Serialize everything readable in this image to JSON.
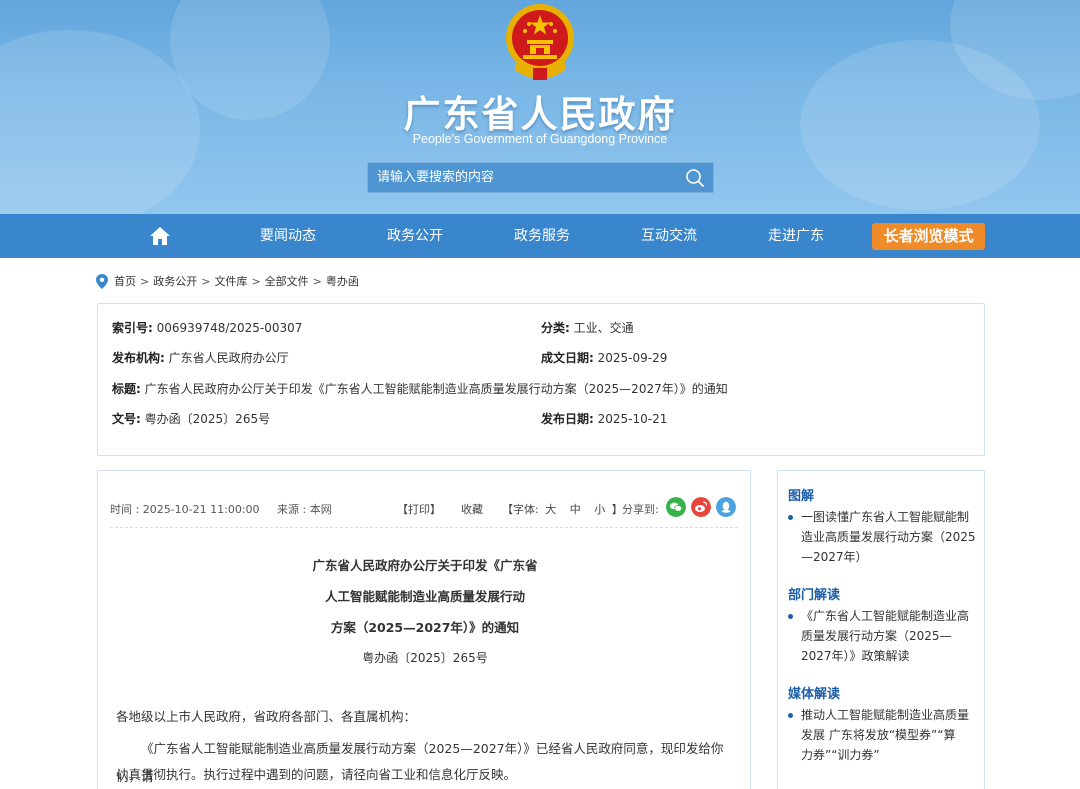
{
  "header": {
    "title": "广东省人民政府",
    "subtitle": "People's Government of Guangdong Province",
    "search_placeholder": "请输入要搜索的内容"
  },
  "nav": {
    "items": [
      "要闻动态",
      "政务公开",
      "政务服务",
      "互动交流",
      "走进广东"
    ],
    "elder_mode": "长者浏览模式"
  },
  "breadcrumb": [
    "首页",
    "政务公开",
    "文件库",
    "全部文件",
    "粤办函"
  ],
  "info": {
    "index_label": "索引号:",
    "index_value": "006939748/2025-00307",
    "category_label": "分类:",
    "category_value": "工业、交通",
    "org_label": "发布机构:",
    "org_value": "广东省人民政府办公厅",
    "created_label": "成文日期:",
    "created_value": "2025-09-29",
    "title_label": "标题:",
    "title_value": "广东省人民政府办公厅关于印发《广东省人工智能赋能制造业高质量发展行动方案（2025—2027年）》的通知",
    "docno_label": "文号:",
    "docno_value": "粤办函〔2025〕265号",
    "published_label": "发布日期:",
    "published_value": "2025-10-21"
  },
  "article": {
    "time": "时间 : 2025-10-21 11:00:00",
    "source": "来源 : 本网",
    "print": "【打印】",
    "favorite": "收藏",
    "font_prefix": "【字体:",
    "font_large": "大",
    "font_medium": "中",
    "font_small": "小",
    "font_suffix": "】",
    "share": "分享到:",
    "title_line1": "广东省人民政府办公厅关于印发《广东省",
    "title_line2": "人工智能赋能制造业高质量发展行动",
    "title_line3": "方案（2025—2027年）》的通知",
    "doc_number": "粤办函〔2025〕265号",
    "salutation": "各地级以上市人民政府，省政府各部门、各直属机构：",
    "body_line1": "《广东省人工智能赋能制造业高质量发展行动方案（2025—2027年）》已经省人民政府同意，现印发给你们，请",
    "body_line2": "认真贯彻执行。执行过程中遇到的问题，请径向省工业和信息化厅反映。"
  },
  "sidebar": {
    "graphic_heading": "图解",
    "graphic_l1": "一图读懂广东省人工智能赋能制",
    "graphic_l2": "造业高质量发展行动方案（2025",
    "graphic_l3": "—2027年）",
    "dept_heading": "部门解读",
    "dept_l1": "《广东省人工智能赋能制造业高",
    "dept_l2": "质量发展行动方案（2025—",
    "dept_l3": "2027年）》政策解读",
    "media_heading": "媒体解读",
    "media_l1": "推动人工智能赋能制造业高质量",
    "media_l2": "发展 广东将发放“模型券”“算",
    "media_l3": "力券”“训力券”"
  },
  "colors": {
    "nav_bg": "#3a86cc",
    "elder_btn": "#f08b2a",
    "heading_blue": "#1c5ea8",
    "wechat": "#35b24a",
    "weibo": "#e6463b",
    "qq": "#4aa3e0"
  }
}
